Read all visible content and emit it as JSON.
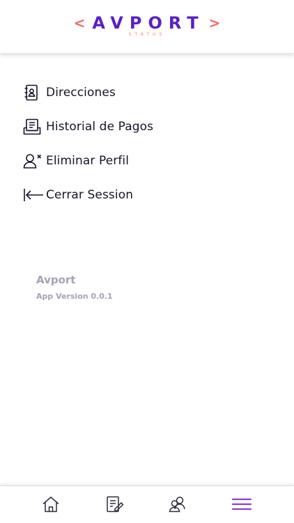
{
  "header": {
    "logo": {
      "left_bracket": "<",
      "word": "AVPORT",
      "right_bracket": ">",
      "subtitle": "STATUS"
    }
  },
  "menu": {
    "items": [
      {
        "label": "Direcciones",
        "icon": "address-book-icon"
      },
      {
        "label": "Historial de Pagos",
        "icon": "receipt-history-icon"
      },
      {
        "label": "Eliminar Perfil",
        "icon": "remove-user-icon"
      },
      {
        "label": "Cerrar Session",
        "icon": "logout-arrow-icon"
      }
    ]
  },
  "app_info": {
    "name": "Avport",
    "version": "App Version 0.0.1"
  },
  "bottom_nav": {
    "items": [
      {
        "icon": "home-icon"
      },
      {
        "icon": "edit-document-icon"
      },
      {
        "icon": "users-icon"
      },
      {
        "icon": "menu-icon",
        "active": true
      }
    ]
  },
  "colors": {
    "brand": "#5a1fc4",
    "accent": "#f06a6a",
    "active_nav": "#8a3fd6",
    "muted_text": "#a3a3b5"
  }
}
